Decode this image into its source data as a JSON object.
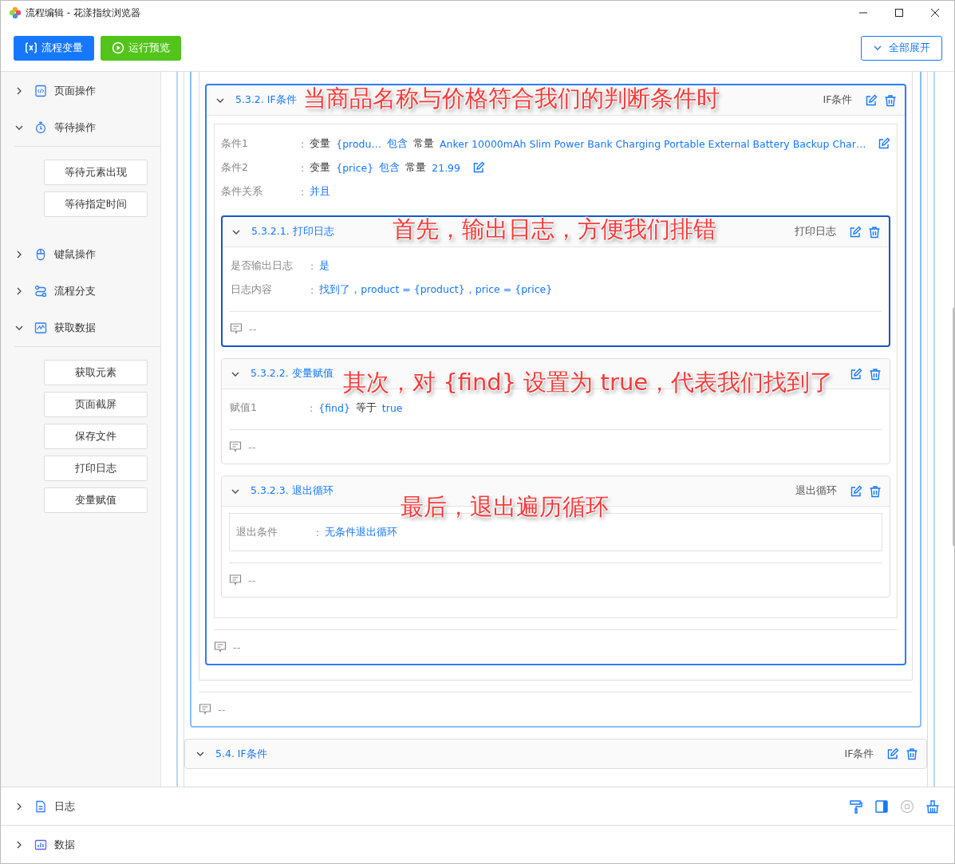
{
  "window": {
    "title": "流程编辑 - 花漾指纹浏览器"
  },
  "toolbar": {
    "buttons": [
      {
        "kind": "variables",
        "label": "流程变量"
      },
      {
        "kind": "run",
        "label": "运行预览"
      }
    ],
    "expand_all": "全部展开"
  },
  "sidebar": {
    "groups": [
      {
        "kind": "page",
        "label": "页面操作",
        "expanded": false
      },
      {
        "kind": "wait",
        "label": "等待操作",
        "expanded": true,
        "items": [
          "等待元素出现",
          "等待指定时间"
        ]
      },
      {
        "kind": "mouse",
        "label": "键鼠操作",
        "expanded": false
      },
      {
        "kind": "branch",
        "label": "流程分支",
        "expanded": false
      },
      {
        "kind": "data",
        "label": "获取数据",
        "expanded": true,
        "items": [
          "获取元素",
          "页面截屏",
          "保存文件",
          "打印日志",
          "变量赋值"
        ]
      }
    ]
  },
  "flow": {
    "card": {
      "title": "5.3.2. IF条件",
      "type": "IF条件",
      "selected": true,
      "conditions": [
        {
          "label": "条件1",
          "colon": ":",
          "parts": [
            {
              "kind": "keyword",
              "text": "变量"
            },
            {
              "kind": "value",
              "text": "{produ…"
            },
            {
              "kind": "value",
              "text": "包含"
            },
            {
              "kind": "keyword",
              "text": "常量"
            },
            {
              "kind": "value",
              "text": "Anker 10000mAh Slim Power Bank Charging Portable External Battery Backup Char…"
            }
          ]
        },
        {
          "label": "条件2",
          "colon": ":",
          "parts": [
            {
              "kind": "keyword",
              "text": "变量"
            },
            {
              "kind": "value",
              "text": "{price}"
            },
            {
              "kind": "value",
              "text": "包含"
            },
            {
              "kind": "keyword",
              "text": "常量"
            },
            {
              "kind": "value",
              "text": "21.99"
            }
          ]
        }
      ],
      "relation": {
        "label": "条件关系",
        "colon": ":",
        "value": "并且"
      },
      "children": [
        {
          "title": "5.3.2.1. 打印日志",
          "type": "打印日志",
          "selected": true,
          "kind": "plain",
          "fields": [
            {
              "label": "是否输出日志",
              "colon": ":",
              "parts": [
                {
                  "kind": "value",
                  "text": "是"
                }
              ]
            },
            {
              "label": "日志内容",
              "colon": ":",
              "parts": [
                {
                  "kind": "value",
                  "text": "找到了，product = {product}，price = {price}"
                }
              ]
            }
          ],
          "comment": "--"
        },
        {
          "title": "5.3.2.2. 变量赋值",
          "selected": false,
          "kind": "plain",
          "fields": [
            {
              "label": "赋值1",
              "colon": ":",
              "parts": [
                {
                  "kind": "value",
                  "text": "{find}"
                },
                {
                  "kind": "keyword",
                  "text": "等于"
                },
                {
                  "kind": "value",
                  "text": "true"
                }
              ]
            }
          ],
          "comment": "--"
        },
        {
          "title": "5.3.2.3. 退出循环",
          "type": "退出循环",
          "selected": false,
          "kind": "boxed",
          "fields": [
            {
              "label": "退出条件",
              "colon": ":",
              "parts": [
                {
                  "kind": "value",
                  "text": "无条件退出循环"
                }
              ]
            }
          ],
          "comment": "--"
        }
      ],
      "comment": "--"
    },
    "outer_comment": "--",
    "next_card": {
      "title": "5.4. IF条件",
      "type": "IF条件"
    }
  },
  "annotations": [
    {
      "text": "当商品名称与价格符合我们的判断条件时"
    },
    {
      "text": "首先，输出日志，方便我们排错"
    },
    {
      "text": "其次，对 {find} 设置为 true，代表我们找到了"
    },
    {
      "text": "最后，退出遍历循环"
    }
  ],
  "bottom_panel": {
    "rows": [
      {
        "kind": "log",
        "label": "日志",
        "expanded": false
      },
      {
        "kind": "data",
        "label": "数据",
        "expanded": false
      }
    ],
    "tools": [
      {
        "kind": "brush",
        "disabled": false
      },
      {
        "kind": "panel",
        "disabled": false
      },
      {
        "kind": "record",
        "disabled": true
      },
      {
        "kind": "clear",
        "disabled": false
      }
    ]
  }
}
